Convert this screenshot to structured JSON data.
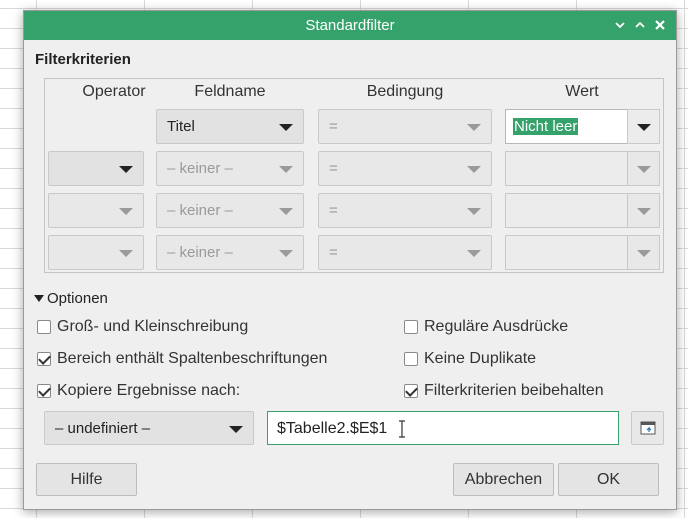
{
  "dialog": {
    "title": "Standardfilter",
    "controls": {
      "minimize": "⌄",
      "maximize": "⌃",
      "close": "✕"
    }
  },
  "criteria": {
    "section_title": "Filterkriterien",
    "headers": {
      "operator": "Operator",
      "field": "Feldname",
      "condition": "Bedingung",
      "value": "Wert"
    },
    "rows": [
      {
        "operator": "",
        "field": "Titel",
        "condition": "=",
        "value": "Nicht leer"
      },
      {
        "operator": "",
        "field": "– keiner –",
        "condition": "=",
        "value": ""
      },
      {
        "operator": "",
        "field": "– keiner –",
        "condition": "=",
        "value": ""
      },
      {
        "operator": "",
        "field": "– keiner –",
        "condition": "=",
        "value": ""
      }
    ]
  },
  "options": {
    "toggle_label": "Optionen",
    "case_sensitive": {
      "label": "Groß- und Kleinschreibung",
      "checked": false
    },
    "regex": {
      "label": "Reguläre Ausdrücke",
      "checked": false
    },
    "has_headers": {
      "label": "Bereich enthält Spaltenbeschriftungen",
      "checked": true
    },
    "no_duplicates": {
      "label": "Keine Duplikate",
      "checked": false
    },
    "copy_results": {
      "label": "Kopiere Ergebnisse nach:",
      "checked": true
    },
    "keep_criteria": {
      "label": "Filterkriterien beibehalten",
      "checked": true
    },
    "copy_target_select": "– undefiniert –",
    "copy_target_input": "$Tabelle2.$E$1"
  },
  "buttons": {
    "help": "Hilfe",
    "cancel": "Abbrechen",
    "ok": "OK"
  },
  "colors": {
    "accent": "#35a26b"
  }
}
